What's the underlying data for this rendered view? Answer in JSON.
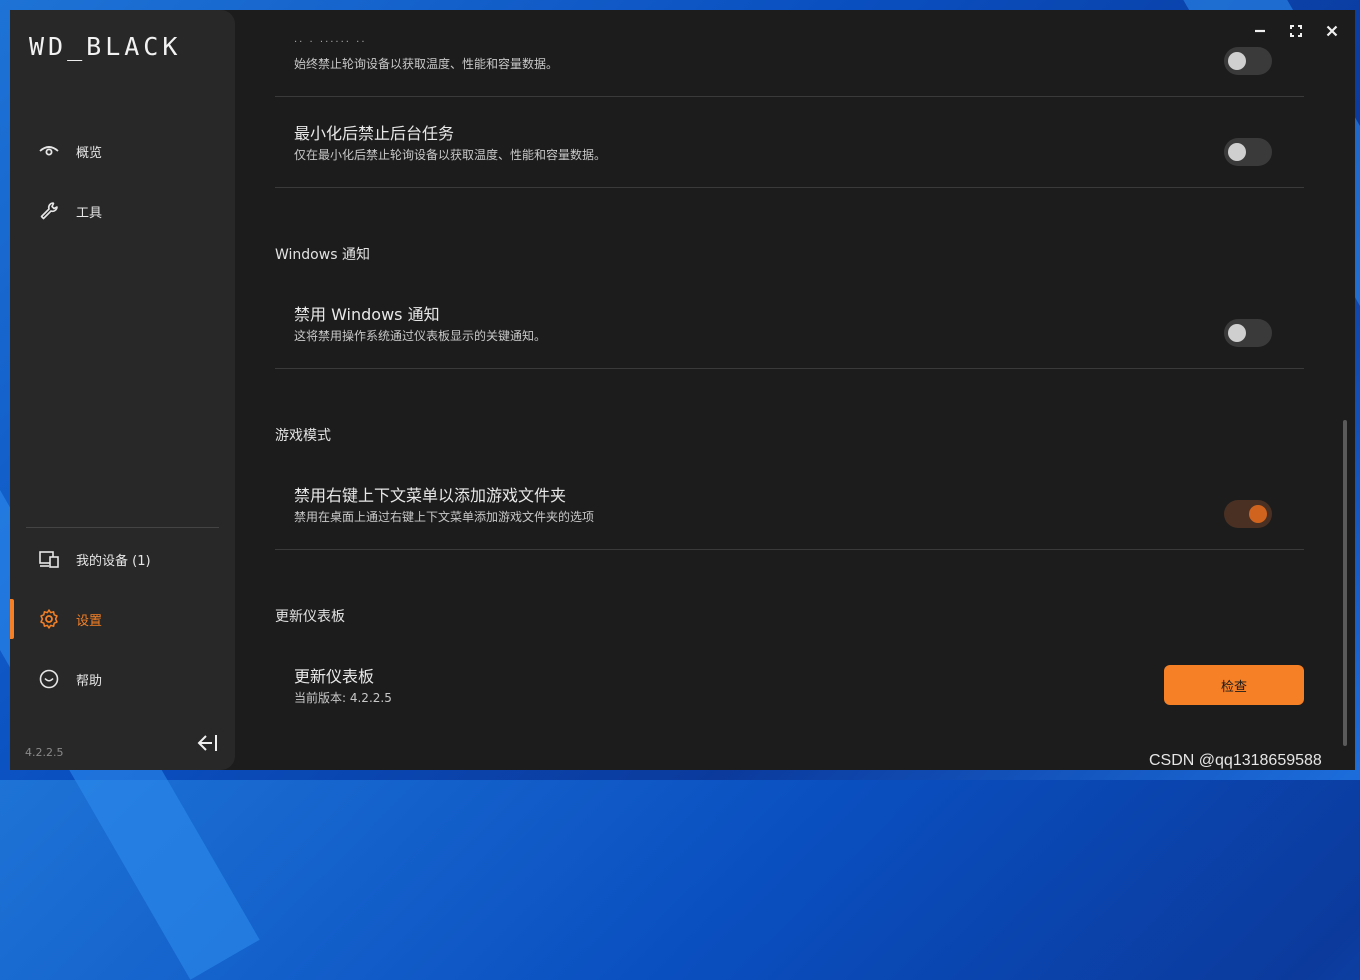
{
  "app": {
    "logo": "WD_BLACK",
    "version": "4.2.2.5"
  },
  "sidebar": {
    "items": [
      {
        "label": "概览",
        "icon": "eye-icon"
      },
      {
        "label": "工具",
        "icon": "wrench-icon"
      },
      {
        "label": "我的设备 (1)",
        "icon": "devices-icon"
      },
      {
        "label": "设置",
        "icon": "gear-icon",
        "active": true
      },
      {
        "label": "帮助",
        "icon": "help-icon"
      }
    ]
  },
  "settings": {
    "clipped_title": "·· · ······ ··",
    "row_poll_disable_desc": "始终禁止轮询设备以获取温度、性能和容量数据。",
    "row_min_title": "最小化后禁止后台任务",
    "row_min_desc": "仅在最小化后禁止轮询设备以获取温度、性能和容量数据。",
    "section_notifications": "Windows 通知",
    "row_notif_title": "禁用 Windows 通知",
    "row_notif_desc": "这将禁用操作系统通过仪表板显示的关键通知。",
    "section_game": "游戏模式",
    "row_game_title": "禁用右键上下文菜单以添加游戏文件夹",
    "row_game_desc": "禁用在桌面上通过右键上下文菜单添加游戏文件夹的选项",
    "section_update": "更新仪表板",
    "row_update_title": "更新仪表板",
    "row_update_desc": "当前版本: 4.2.2.5",
    "check_button": "检查"
  },
  "toggles": {
    "poll_disable": false,
    "minimize_disable": false,
    "notifications_disable": false,
    "game_context_disable": true
  },
  "colors": {
    "accent": "#f58025",
    "sidebar_bg": "#282828",
    "content_bg": "#1c1c1c"
  },
  "watermark": "CSDN @qq1318659588"
}
